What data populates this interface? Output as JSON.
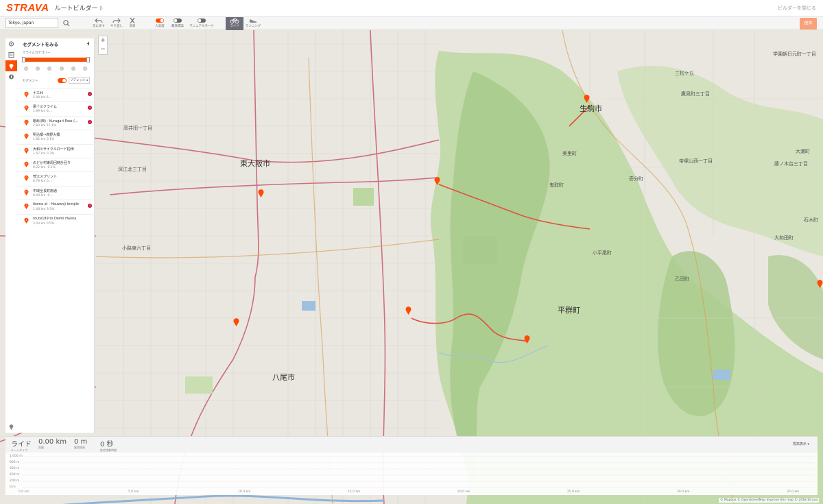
{
  "header": {
    "logo": "STRAVA",
    "title": "ルートビルダー",
    "title_mark": "β",
    "exit": "ビルダーを閉じる"
  },
  "toolbar": {
    "search_value": "Tokyo, Japan",
    "undo": "元に戻す",
    "redo": "やり直し",
    "clear": "消去",
    "popularity": "人気度",
    "min_elevation": "最低標高",
    "manual_mode": "マニュアルモード",
    "ride": "ライド",
    "run": "ランニング",
    "save": "保存"
  },
  "segments": {
    "title": "セグメントをみる",
    "collapse_icon": "chevron-left-icon",
    "category_label": "クライムカテゴリー",
    "category_dots": [
      "NC",
      "4",
      "3",
      "2",
      "1",
      "HC"
    ],
    "section_label": "セグメント",
    "refresh": "リフレッシュ",
    "items": [
      {
        "letter": "A",
        "name": "十三峠",
        "stats": "5.98 km   6....",
        "badge": "2"
      },
      {
        "letter": "B",
        "name": "裏十三クライム",
        "stats": "1.99 km   6....",
        "badge": "4"
      },
      {
        "letter": "C",
        "name": "暗峠(西) - Kuragari Pass (...",
        "stats": "2.83 km   15.1%",
        "badge": "2"
      },
      {
        "letter": "D",
        "name": "明治橋→高野大橋",
        "stats": "1.82 km   0.1%",
        "badge": ""
      },
      {
        "letter": "E",
        "name": "大和川サイクルロード柏田",
        "stats": "1.67 km   0.3%",
        "badge": ""
      },
      {
        "letter": "F",
        "name": "のどか村東周回時計回り",
        "stats": "6.22 km   -0.1%",
        "badge": ""
      },
      {
        "letter": "G",
        "name": "菅江スプリント",
        "stats": "0.78 km   0....",
        "badge": ""
      },
      {
        "letter": "H",
        "name": "中環全長町南通",
        "stats": "0.90 km   -0....",
        "badge": ""
      },
      {
        "letter": "I",
        "name": "ikoma st - Houzanji temple",
        "stats": "1.48 km   9.3%",
        "badge": "4"
      },
      {
        "letter": "J",
        "name": "route189 to Deimi Hanna",
        "stats": "3.03 km   0.5%",
        "badge": ""
      }
    ]
  },
  "map_labels": {
    "higashiosaka": "東大阪市",
    "ikoma": "生駒市",
    "yao": "八尾市",
    "heguri": "平群町",
    "fukae": "深江北三丁目",
    "kojiHigashi": "小路東六丁目",
    "takaida": "高井田一丁目",
    "kitaSasaki": "北大阪町",
    "misato": "美里町",
    "kitoro": "鬼取町",
    "kamiyoshi": "帝塚山西一丁目",
    "ichibun": "壱分町",
    "kohirao": "小平尾町",
    "ikaruga": "乙田町",
    "kawachi": "大和田町",
    "ishiki": "石木町",
    "ninomiya": "大瀬町",
    "gakuen": "学園朝日元町一丁目",
    "mitsugaoka": "三松ケ丘",
    "takami": "鷹見町三丁目",
    "nagisa": "藤ノ木台三丁目",
    "shibahara": "柴原町"
  },
  "elevation": {
    "activity": "ライド",
    "route_type": "ルートタイプ",
    "distance_value": "0.00 km",
    "distance_label": "距離",
    "elevation_value": "0 m",
    "elevation_label": "獲得標高",
    "time_value": "0 秒",
    "time_label": "推定移動時間",
    "chart_type": "標高表示",
    "y_ticks": [
      "1,000 m",
      "800 m",
      "600 m",
      "400 m",
      "200 m",
      "0 m"
    ],
    "x_ticks": [
      "0.0 km",
      "5.0 km",
      "10.0 km",
      "15.0 km",
      "20.0 km",
      "25.0 km",
      "30.0 km",
      "35.0 km"
    ]
  },
  "attribution": "© Mapbox © OpenStreetMap Improve this map © 2018 Strava",
  "colors": {
    "brand": "#fc4c02",
    "route": "#e0503c",
    "forest": "#b7d39a"
  }
}
